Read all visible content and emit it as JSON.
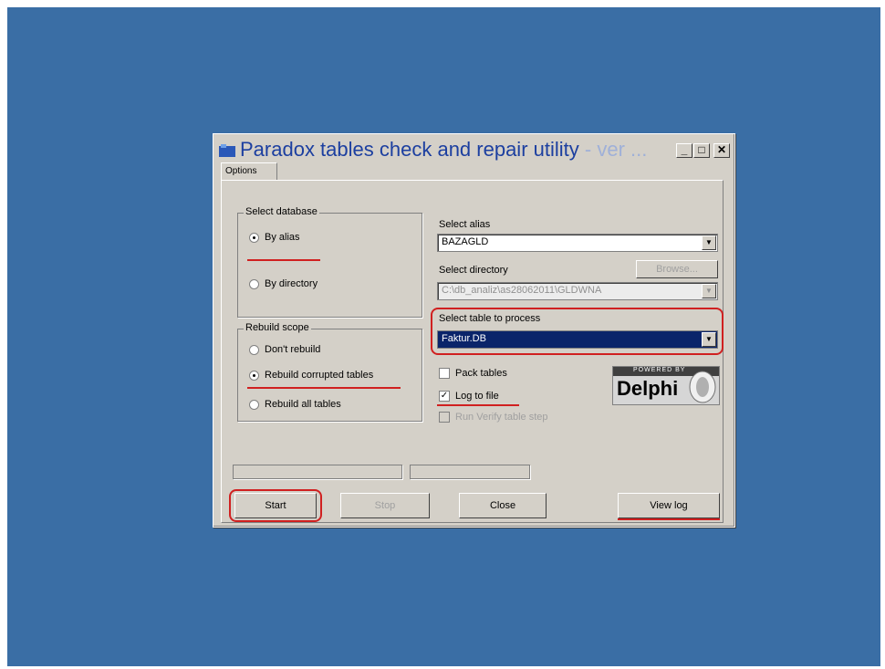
{
  "window": {
    "title_main": "Paradox tables check and repair utility",
    "title_faded": "- ver ...",
    "minimize": "_",
    "maximize": "□",
    "close": "✕"
  },
  "tabs": {
    "options": "Options"
  },
  "select_database": {
    "legend": "Select database",
    "by_alias": "By alias",
    "by_directory": "By directory"
  },
  "alias": {
    "label": "Select alias",
    "value": "BAZAGLD"
  },
  "directory": {
    "label": "Select directory",
    "value": "C:\\db_analiz\\as28062011\\GLDWNA",
    "browse": "Browse..."
  },
  "table": {
    "label": "Select table to process",
    "value": "Faktur.DB"
  },
  "rebuild_scope": {
    "legend": "Rebuild scope",
    "dont_rebuild": "Don't rebuild",
    "rebuild_corrupted": "Rebuild corrupted tables",
    "rebuild_all": "Rebuild all tables"
  },
  "options": {
    "pack_tables": "Pack tables",
    "log_to_file": "Log to file",
    "run_verify": "Run Verify table step"
  },
  "delphi": {
    "powered": "POWERED BY",
    "name": "Delphi"
  },
  "buttons": {
    "start": "Start",
    "stop": "Stop",
    "close": "Close",
    "view_log": "View log"
  },
  "colors": {
    "desktop": "#3a6ea5",
    "window": "#d4d0c8",
    "selection": "#0a246a",
    "highlight": "#d02020"
  }
}
